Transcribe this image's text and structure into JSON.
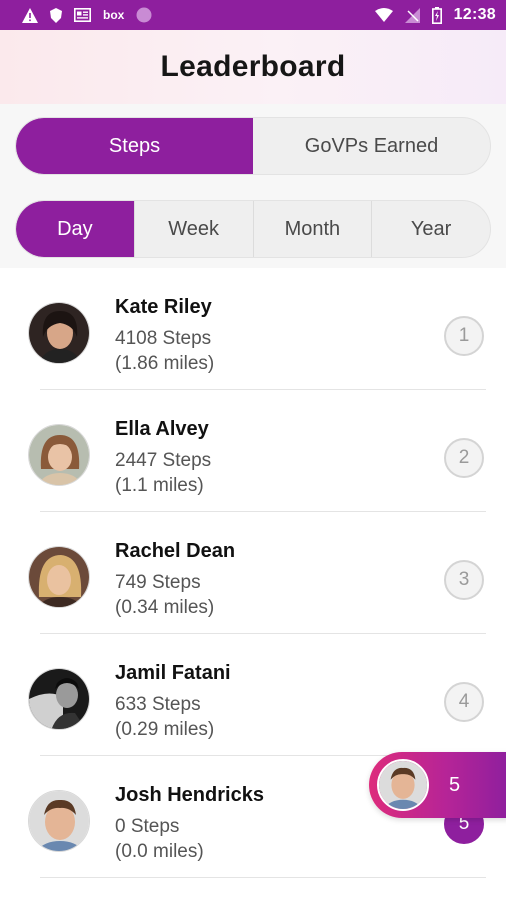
{
  "status_bar": {
    "time": "12:38",
    "left_icons": [
      "warning-icon",
      "shield-icon",
      "news-icon",
      "box-app-icon",
      "circle-app-icon"
    ],
    "box_label": "box",
    "right_icons": [
      "wifi-icon",
      "no-signal-icon",
      "battery-charging-icon"
    ]
  },
  "header": {
    "title": "Leaderboard"
  },
  "metric_tabs": {
    "items": [
      "Steps",
      "GoVPs Earned"
    ],
    "selected": "Steps"
  },
  "period_tabs": {
    "items": [
      "Day",
      "Week",
      "Month",
      "Year"
    ],
    "selected": "Day"
  },
  "leaders": [
    {
      "name": "Kate Riley",
      "steps": "4108 Steps",
      "miles": "(1.86 miles)",
      "rank": "1"
    },
    {
      "name": "Ella Alvey",
      "steps": "2447 Steps",
      "miles": "(1.1 miles)",
      "rank": "2"
    },
    {
      "name": "Rachel Dean",
      "steps": "749 Steps",
      "miles": "(0.34 miles)",
      "rank": "3"
    },
    {
      "name": "Jamil Fatani",
      "steps": "633 Steps",
      "miles": "(0.29 miles)",
      "rank": "4"
    },
    {
      "name": "Josh Hendricks",
      "steps": "0 Steps",
      "miles": "(0.0 miles)",
      "rank": "5"
    }
  ],
  "my_rank": {
    "rank": "5"
  },
  "colors": {
    "accent": "#8e1f9e",
    "pill_start": "#dd2c7c",
    "pill_end": "#8e1f9e",
    "header_bg": "#fbe9ec"
  }
}
